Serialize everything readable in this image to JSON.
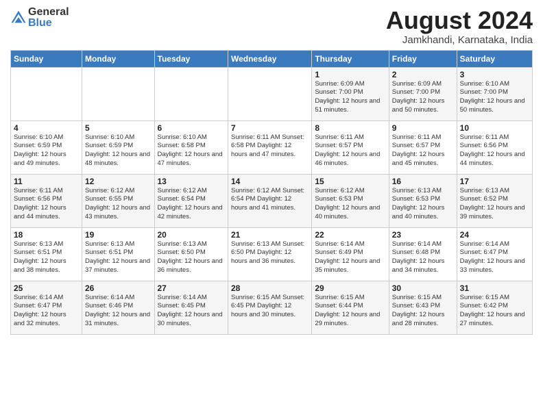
{
  "header": {
    "logo_general": "General",
    "logo_blue": "Blue",
    "month_year": "August 2024",
    "location": "Jamkhandi, Karnataka, India"
  },
  "weekdays": [
    "Sunday",
    "Monday",
    "Tuesday",
    "Wednesday",
    "Thursday",
    "Friday",
    "Saturday"
  ],
  "weeks": [
    [
      {
        "day": "",
        "info": ""
      },
      {
        "day": "",
        "info": ""
      },
      {
        "day": "",
        "info": ""
      },
      {
        "day": "",
        "info": ""
      },
      {
        "day": "1",
        "info": "Sunrise: 6:09 AM\nSunset: 7:00 PM\nDaylight: 12 hours\nand 51 minutes."
      },
      {
        "day": "2",
        "info": "Sunrise: 6:09 AM\nSunset: 7:00 PM\nDaylight: 12 hours\nand 50 minutes."
      },
      {
        "day": "3",
        "info": "Sunrise: 6:10 AM\nSunset: 7:00 PM\nDaylight: 12 hours\nand 50 minutes."
      }
    ],
    [
      {
        "day": "4",
        "info": "Sunrise: 6:10 AM\nSunset: 6:59 PM\nDaylight: 12 hours\nand 49 minutes."
      },
      {
        "day": "5",
        "info": "Sunrise: 6:10 AM\nSunset: 6:59 PM\nDaylight: 12 hours\nand 48 minutes."
      },
      {
        "day": "6",
        "info": "Sunrise: 6:10 AM\nSunset: 6:58 PM\nDaylight: 12 hours\nand 47 minutes."
      },
      {
        "day": "7",
        "info": "Sunrise: 6:11 AM\nSunset: 6:58 PM\nDaylight: 12 hours\nand 47 minutes."
      },
      {
        "day": "8",
        "info": "Sunrise: 6:11 AM\nSunset: 6:57 PM\nDaylight: 12 hours\nand 46 minutes."
      },
      {
        "day": "9",
        "info": "Sunrise: 6:11 AM\nSunset: 6:57 PM\nDaylight: 12 hours\nand 45 minutes."
      },
      {
        "day": "10",
        "info": "Sunrise: 6:11 AM\nSunset: 6:56 PM\nDaylight: 12 hours\nand 44 minutes."
      }
    ],
    [
      {
        "day": "11",
        "info": "Sunrise: 6:11 AM\nSunset: 6:56 PM\nDaylight: 12 hours\nand 44 minutes."
      },
      {
        "day": "12",
        "info": "Sunrise: 6:12 AM\nSunset: 6:55 PM\nDaylight: 12 hours\nand 43 minutes."
      },
      {
        "day": "13",
        "info": "Sunrise: 6:12 AM\nSunset: 6:54 PM\nDaylight: 12 hours\nand 42 minutes."
      },
      {
        "day": "14",
        "info": "Sunrise: 6:12 AM\nSunset: 6:54 PM\nDaylight: 12 hours\nand 41 minutes."
      },
      {
        "day": "15",
        "info": "Sunrise: 6:12 AM\nSunset: 6:53 PM\nDaylight: 12 hours\nand 40 minutes."
      },
      {
        "day": "16",
        "info": "Sunrise: 6:13 AM\nSunset: 6:53 PM\nDaylight: 12 hours\nand 40 minutes."
      },
      {
        "day": "17",
        "info": "Sunrise: 6:13 AM\nSunset: 6:52 PM\nDaylight: 12 hours\nand 39 minutes."
      }
    ],
    [
      {
        "day": "18",
        "info": "Sunrise: 6:13 AM\nSunset: 6:51 PM\nDaylight: 12 hours\nand 38 minutes."
      },
      {
        "day": "19",
        "info": "Sunrise: 6:13 AM\nSunset: 6:51 PM\nDaylight: 12 hours\nand 37 minutes."
      },
      {
        "day": "20",
        "info": "Sunrise: 6:13 AM\nSunset: 6:50 PM\nDaylight: 12 hours\nand 36 minutes."
      },
      {
        "day": "21",
        "info": "Sunrise: 6:13 AM\nSunset: 6:50 PM\nDaylight: 12 hours\nand 36 minutes."
      },
      {
        "day": "22",
        "info": "Sunrise: 6:14 AM\nSunset: 6:49 PM\nDaylight: 12 hours\nand 35 minutes."
      },
      {
        "day": "23",
        "info": "Sunrise: 6:14 AM\nSunset: 6:48 PM\nDaylight: 12 hours\nand 34 minutes."
      },
      {
        "day": "24",
        "info": "Sunrise: 6:14 AM\nSunset: 6:47 PM\nDaylight: 12 hours\nand 33 minutes."
      }
    ],
    [
      {
        "day": "25",
        "info": "Sunrise: 6:14 AM\nSunset: 6:47 PM\nDaylight: 12 hours\nand 32 minutes."
      },
      {
        "day": "26",
        "info": "Sunrise: 6:14 AM\nSunset: 6:46 PM\nDaylight: 12 hours\nand 31 minutes."
      },
      {
        "day": "27",
        "info": "Sunrise: 6:14 AM\nSunset: 6:45 PM\nDaylight: 12 hours\nand 30 minutes."
      },
      {
        "day": "28",
        "info": "Sunrise: 6:15 AM\nSunset: 6:45 PM\nDaylight: 12 hours\nand 30 minutes."
      },
      {
        "day": "29",
        "info": "Sunrise: 6:15 AM\nSunset: 6:44 PM\nDaylight: 12 hours\nand 29 minutes."
      },
      {
        "day": "30",
        "info": "Sunrise: 6:15 AM\nSunset: 6:43 PM\nDaylight: 12 hours\nand 28 minutes."
      },
      {
        "day": "31",
        "info": "Sunrise: 6:15 AM\nSunset: 6:42 PM\nDaylight: 12 hours\nand 27 minutes."
      }
    ]
  ]
}
